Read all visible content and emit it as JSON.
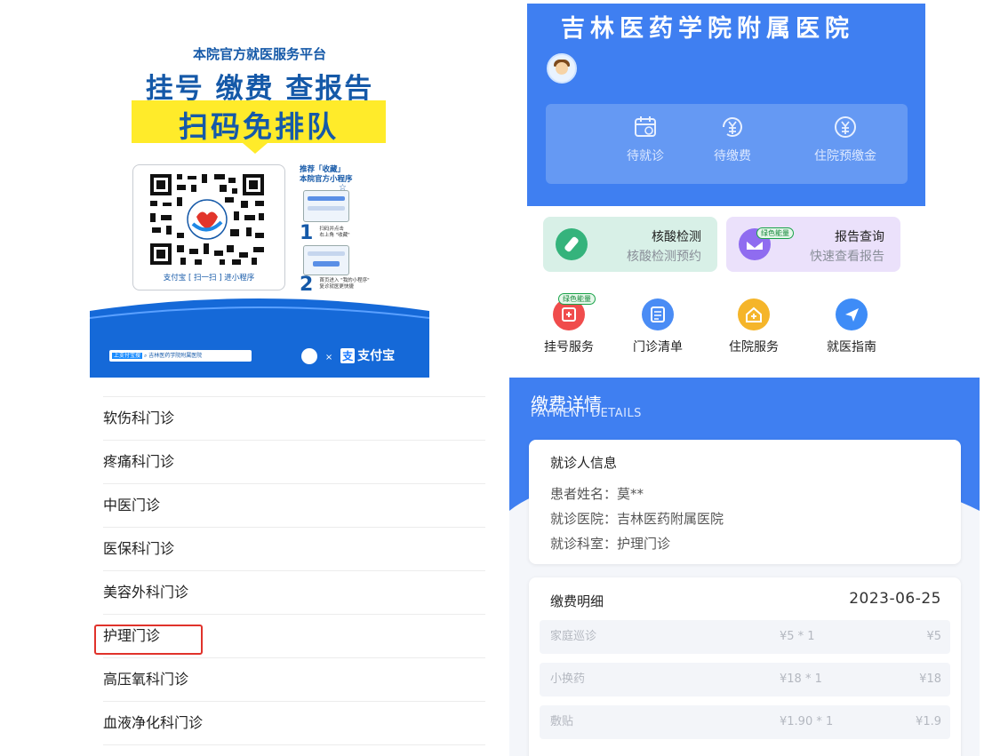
{
  "poster": {
    "tagline": "本院官方就医服务平台",
    "headline": "挂号 缴费 查报告",
    "scan_free": "扫码免排队",
    "qr_caption": "支付宝 [ 扫一扫 ] 进小程序",
    "recommend_line1": "推荐「收藏」",
    "recommend_line2": "本院官方小程序",
    "step1_num": "1",
    "step1_text_a": "扫码并点击",
    "step1_text_b": "右上角 \"收藏\"",
    "step2_num": "2",
    "step2_text_a": "首页进入 \"我的小程序\"",
    "step2_text_b": "复诊就医更快捷",
    "search_prefix": "上支付宝搜",
    "search_value": "吉林医药学院附属医院",
    "partner_times": "×",
    "alipay_label": "支付宝"
  },
  "mini": {
    "hospital_title": "吉林医药学院附属医院",
    "quick_items": [
      {
        "label": "待就诊",
        "icon": "calendar-add-icon"
      },
      {
        "label": "待缴费",
        "icon": "yen-bill-icon"
      },
      {
        "label": "住院预缴金",
        "icon": "yen-coin-icon"
      }
    ],
    "cards": [
      {
        "title": "核酸检测",
        "subtitle": "核酸检测预约",
        "icon": "test-tube-icon",
        "color": "#35b37c"
      },
      {
        "title": "报告查询",
        "subtitle": "快速查看报告",
        "icon": "report-icon",
        "color": "#8f6cf0",
        "badge": "绿色能量"
      }
    ],
    "services": [
      {
        "label": "挂号服务",
        "icon": "register-icon",
        "color": "#f04c4c",
        "badge": "绿色能量"
      },
      {
        "label": "门诊清单",
        "icon": "list-icon",
        "color": "#4a8cf5"
      },
      {
        "label": "住院服务",
        "icon": "hospital-icon",
        "color": "#f5b52a"
      },
      {
        "label": "就医指南",
        "icon": "navigation-icon",
        "color": "#3e8cf7"
      }
    ]
  },
  "departments": {
    "items": [
      "软伤科门诊",
      "疼痛科门诊",
      "中医门诊",
      "医保科门诊",
      "美容外科门诊",
      "护理门诊",
      "高压氧科门诊",
      "血液净化科门诊"
    ],
    "highlighted": "护理门诊",
    "highlight_color": "#e0322b"
  },
  "payment": {
    "title": "缴费详情",
    "subtitle": "PAYMENT DETAILS",
    "patient_header": "就诊人信息",
    "patient_name": "患者姓名：莫**",
    "hospital": "就诊医院：吉林医药附属医院",
    "department": "就诊科室：护理门诊",
    "detail_header": "缴费明细",
    "date": "2023-06-25",
    "items": [
      {
        "name": "家庭巡诊",
        "price": "¥5 * 1",
        "total": "¥5"
      },
      {
        "name": "小换药",
        "price": "¥18 * 1",
        "total": "¥18"
      },
      {
        "name": "敷贴",
        "price": "¥1.90 * 1",
        "total": "¥1.9"
      }
    ]
  }
}
